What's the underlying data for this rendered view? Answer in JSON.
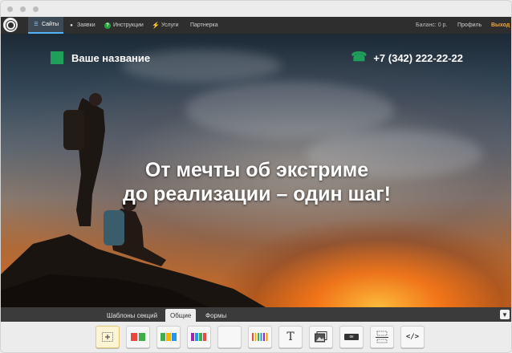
{
  "topnav": {
    "items": [
      {
        "label": "Сайты",
        "icon": "list-icon",
        "active": true
      },
      {
        "label": "Заявки",
        "icon": "user-icon"
      },
      {
        "label": "Инструкции",
        "icon": "help-icon"
      },
      {
        "label": "Услуги",
        "icon": "bolt-icon"
      },
      {
        "label": "Партнерка"
      }
    ],
    "balance": "Баланс: 0 р.",
    "profile": "Профиль",
    "logout": "Выход"
  },
  "hero": {
    "brand": "Ваше название",
    "phone": "+7 (342) 222-22-22",
    "headline_line1": "От мечты об экстриме",
    "headline_line2": "до реализации – один шаг!"
  },
  "panel": {
    "tabs": [
      {
        "label": "Шаблоны секций"
      },
      {
        "label": "Общие",
        "active": true
      },
      {
        "label": "Формы"
      }
    ]
  },
  "toolbar": {
    "text_tool_glyph": "T",
    "button_tool_label": "ок",
    "code_tool_glyph": "</>"
  },
  "colors": {
    "accent_green": "#1fa05a",
    "nav_bg": "#2e2e2e",
    "active_tab_underline": "#55b0ff",
    "logout": "#f3a63a"
  }
}
